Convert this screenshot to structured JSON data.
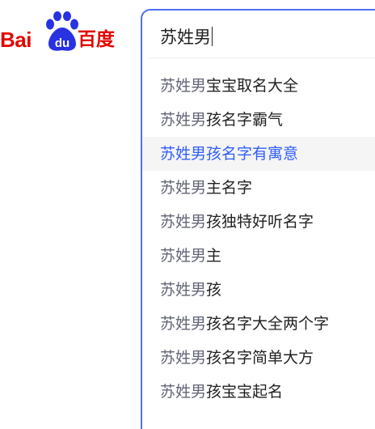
{
  "logo": {
    "text_latin": "Bai",
    "text_paw": "du",
    "text_chinese": "百度"
  },
  "search": {
    "query": "苏姓男"
  },
  "suggestions": [
    {
      "prefix": "苏姓男",
      "rest": "宝宝取名大全",
      "active": false
    },
    {
      "prefix": "苏姓男",
      "rest": "孩名字霸气",
      "active": false
    },
    {
      "prefix": "苏姓男",
      "rest": "孩名字有寓意",
      "active": true
    },
    {
      "prefix": "苏姓男",
      "rest": "主名字",
      "active": false
    },
    {
      "prefix": "苏姓男",
      "rest": "孩独特好听名字",
      "active": false
    },
    {
      "prefix": "苏姓男",
      "rest": "主",
      "active": false
    },
    {
      "prefix": "苏姓男",
      "rest": "孩",
      "active": false
    },
    {
      "prefix": "苏姓男",
      "rest": "孩名字大全两个字",
      "active": false
    },
    {
      "prefix": "苏姓男",
      "rest": "孩名字简单大方",
      "active": false
    },
    {
      "prefix": "苏姓男",
      "rest": "孩宝宝起名",
      "active": false
    }
  ],
  "colors": {
    "brand_red": "#e10601",
    "brand_blue": "#2932e1",
    "search_border": "#4e6ef2",
    "active_text": "#315efb"
  },
  "icons": {
    "logo_mark": "paw-icon"
  }
}
